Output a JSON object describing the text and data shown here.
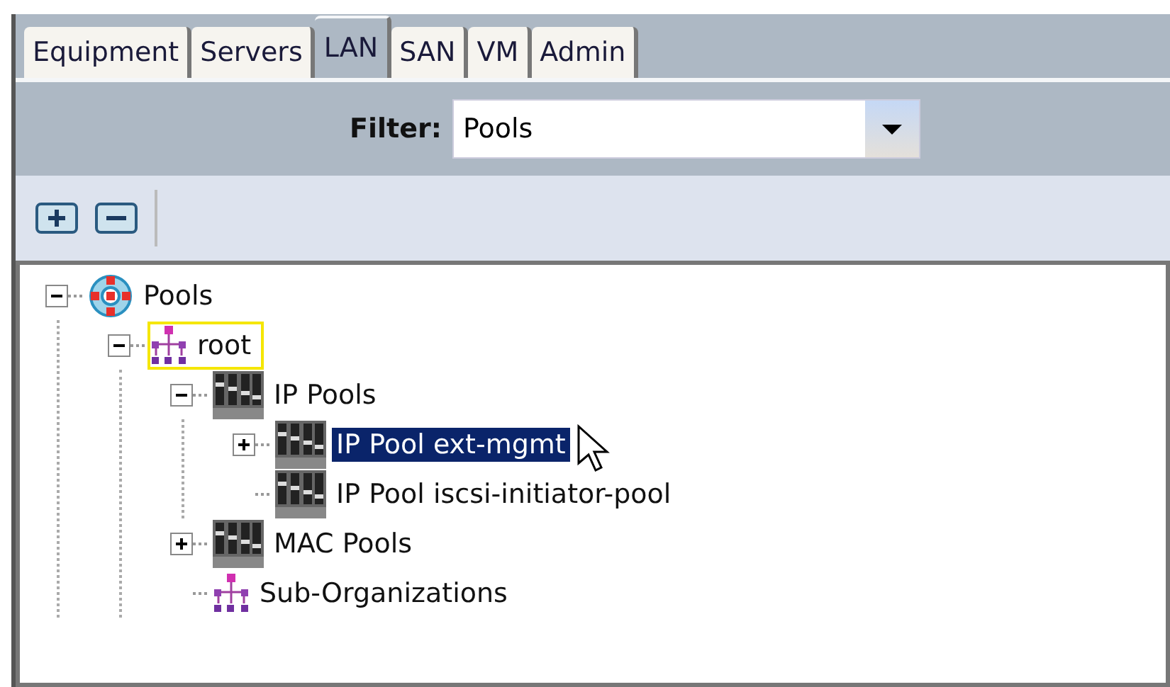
{
  "tabs": [
    {
      "label": "Equipment",
      "selected": false
    },
    {
      "label": "Servers",
      "selected": false
    },
    {
      "label": "LAN",
      "selected": true
    },
    {
      "label": "SAN",
      "selected": false
    },
    {
      "label": "VM",
      "selected": false
    },
    {
      "label": "Admin",
      "selected": false
    }
  ],
  "filter": {
    "label": "Filter:",
    "value": "Pools"
  },
  "tree": [
    {
      "label": "Pools",
      "kind": "pools",
      "expanded": true,
      "selected": false,
      "focused": false,
      "children": [
        {
          "label": "root",
          "kind": "org",
          "expanded": true,
          "selected": false,
          "focused": true,
          "children": [
            {
              "label": "IP Pools",
              "kind": "pool",
              "expanded": true,
              "selected": false,
              "focused": false,
              "children": [
                {
                  "label": "IP Pool ext-mgmt",
                  "kind": "pool",
                  "expanded": false,
                  "selected": true,
                  "focused": false
                },
                {
                  "label": "IP Pool iscsi-initiator-pool",
                  "kind": "pool",
                  "selected": false,
                  "focused": false
                }
              ]
            },
            {
              "label": "MAC Pools",
              "kind": "pool",
              "expanded": false,
              "selected": false,
              "focused": false
            },
            {
              "label": "Sub-Organizations",
              "kind": "org",
              "selected": false,
              "focused": false
            }
          ]
        }
      ]
    }
  ]
}
